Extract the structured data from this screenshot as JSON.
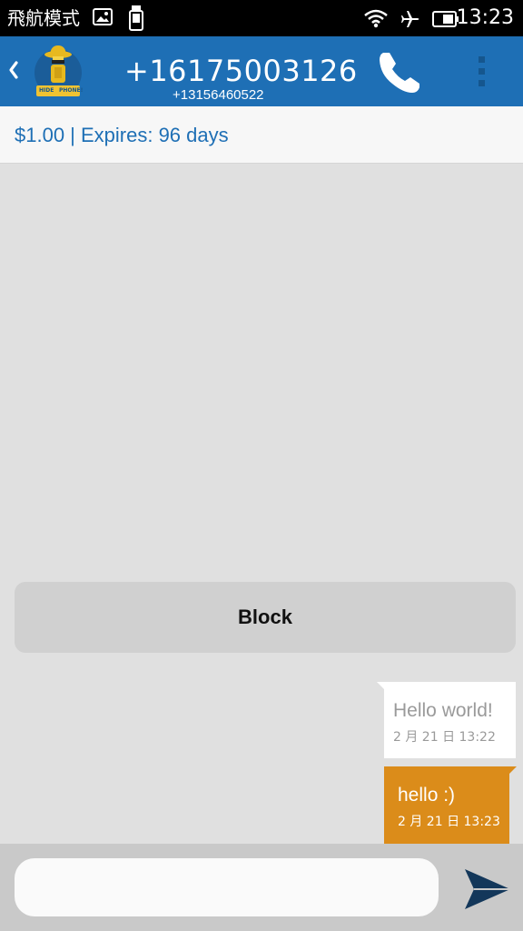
{
  "status_bar": {
    "mode": "飛航模式",
    "time": "13:23",
    "icons": [
      "image-icon",
      "phone-storage-icon",
      "wifi-icon",
      "airplane-icon",
      "battery-icon"
    ]
  },
  "header": {
    "back_icon": "chevron-left-icon",
    "logo_text_left": "HIDE",
    "logo_text_right": "PHONE!",
    "title": "+16175003126",
    "subtitle": "+13156460522",
    "call_icon": "phone-icon",
    "menu_icon": "overflow-menu-icon",
    "colors": {
      "primary": "#1e6fb5",
      "accent": "#db8c1a"
    }
  },
  "info": {
    "text": "$1.00 | Expires: 96 days"
  },
  "block_button": {
    "label": "Block"
  },
  "messages": [
    {
      "direction": "incoming",
      "text": "Hello world!",
      "time": "2 月 21 日 13:22"
    },
    {
      "direction": "outgoing",
      "text": "hello :)",
      "time": "2 月 21 日 13:23"
    }
  ],
  "compose": {
    "placeholder": "",
    "value": "",
    "send_icon": "send-icon"
  }
}
